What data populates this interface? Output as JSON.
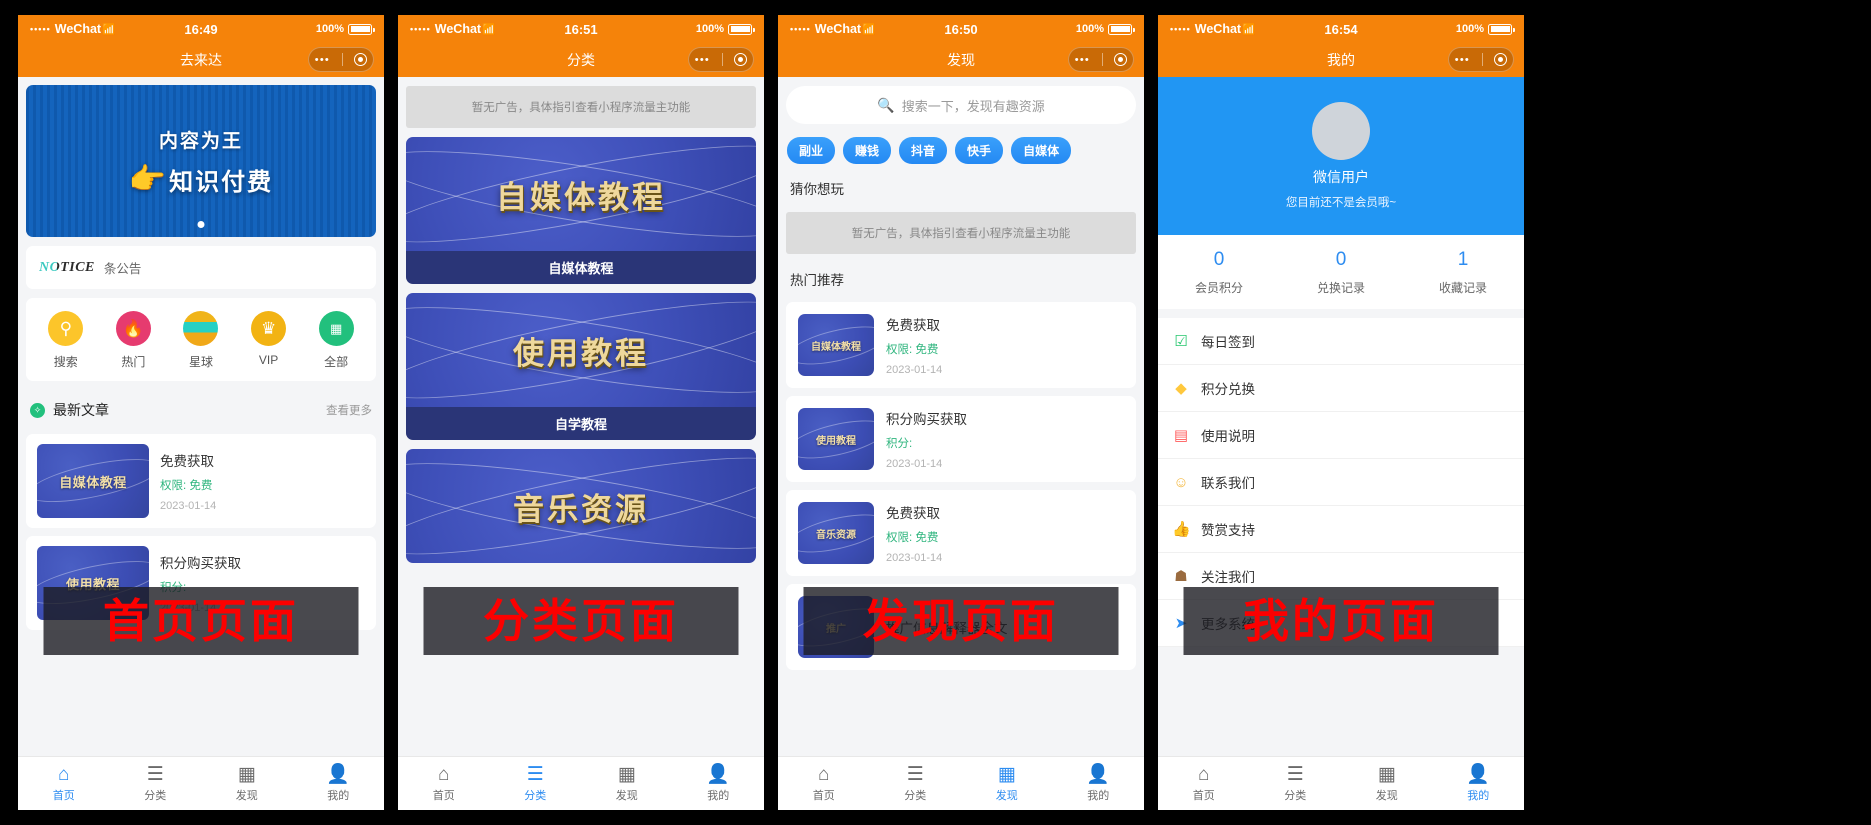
{
  "panels": [
    {
      "status": {
        "carrier": "WeChat",
        "dots": "•••••",
        "wifi": "⌃",
        "time": "16:49",
        "battery": "100%"
      },
      "nav": {
        "title": "去来达"
      },
      "overlay_label": "首页页面",
      "banner": {
        "line1": "内容为王",
        "line2": "知识付费",
        "hand_icon": "point-right-hand-icon"
      },
      "notice": {
        "logo": "NOTICE",
        "text": "条公告"
      },
      "icon_grid": [
        {
          "label": "搜索",
          "icon": "magnifier-icon",
          "glyph": "⌕",
          "color": "#fcc52a"
        },
        {
          "label": "热门",
          "icon": "flame-icon",
          "glyph": "🔥",
          "color": "#e63b6f"
        },
        {
          "label": "星球",
          "icon": "planet-icon",
          "glyph": "",
          "color": "#f0a818"
        },
        {
          "label": "VIP",
          "icon": "crown-icon",
          "glyph": "♕",
          "color": "#f2b313"
        },
        {
          "label": "全部",
          "icon": "grid-icon",
          "glyph": "▦",
          "color": "#22c07d"
        }
      ],
      "section": {
        "title": "最新文章",
        "more": "查看更多",
        "dot_icon": "leaf-icon"
      },
      "articles": [
        {
          "thumb_text": "自媒体教程",
          "title": "免费获取",
          "permission": "权限: 免费",
          "date": "2023-01-14"
        },
        {
          "thumb_text": "使用教程",
          "title": "积分购买获取",
          "permission": "积分:",
          "date": "2023-01-14"
        }
      ],
      "tabbar": [
        {
          "label": "首页",
          "icon": "home-icon",
          "glyph": "⌂",
          "active": true
        },
        {
          "label": "分类",
          "icon": "list-icon",
          "glyph": "☰",
          "active": false
        },
        {
          "label": "发现",
          "icon": "grid-icon",
          "glyph": "▦",
          "active": false
        },
        {
          "label": "我的",
          "icon": "person-icon",
          "glyph": "👤",
          "active": false
        }
      ]
    },
    {
      "status": {
        "carrier": "WeChat",
        "dots": "•••••",
        "wifi": "⌃",
        "time": "16:51",
        "battery": "100%"
      },
      "nav": {
        "title": "分类"
      },
      "overlay_label": "分类页面",
      "ad_placeholder": "暂无广告，具体指引查看小程序流量主功能",
      "category_cards": [
        {
          "image_text": "自媒体教程",
          "caption": "自媒体教程"
        },
        {
          "image_text": "使用教程",
          "caption": "自学教程"
        },
        {
          "image_text": "音乐资源",
          "caption": ""
        }
      ],
      "tabbar": [
        {
          "label": "首页",
          "icon": "home-icon",
          "glyph": "⌂",
          "active": false
        },
        {
          "label": "分类",
          "icon": "list-icon",
          "glyph": "☰",
          "active": true
        },
        {
          "label": "发现",
          "icon": "grid-icon",
          "glyph": "▦",
          "active": false
        },
        {
          "label": "我的",
          "icon": "person-icon",
          "glyph": "👤",
          "active": false
        }
      ]
    },
    {
      "status": {
        "carrier": "WeChat",
        "dots": "•••••",
        "wifi": "⌃",
        "time": "16:50",
        "battery": "100%"
      },
      "nav": {
        "title": "发现"
      },
      "overlay_label": "发现页面",
      "search": {
        "placeholder": "搜索一下，发现有趣资源",
        "icon": "search-icon"
      },
      "tags": [
        "副业",
        "赚钱",
        "抖音",
        "快手",
        "自媒体"
      ],
      "guess_title": "猜你想玩",
      "ad_placeholder": "暂无广告，具体指引查看小程序流量主功能",
      "hot_title": "热门推荐",
      "hot_items": [
        {
          "thumb_text": "自媒体教程",
          "title": "免费获取",
          "permission": "权限: 免费",
          "date": "2023-01-14"
        },
        {
          "thumb_text": "使用教程",
          "title": "积分购买获取",
          "permission": "积分:",
          "date": "2023-01-14"
        },
        {
          "thumb_text": "音乐资源",
          "title": "免费获取",
          "permission": "权限: 免费",
          "date": "2023-01-14"
        },
        {
          "thumb_text": "推广",
          "title": "推广信息解释器全文",
          "permission": "",
          "date": ""
        }
      ],
      "tabbar": [
        {
          "label": "首页",
          "icon": "home-icon",
          "glyph": "⌂",
          "active": false
        },
        {
          "label": "分类",
          "icon": "list-icon",
          "glyph": "☰",
          "active": false
        },
        {
          "label": "发现",
          "icon": "grid-icon",
          "glyph": "▦",
          "active": true
        },
        {
          "label": "我的",
          "icon": "person-icon",
          "glyph": "👤",
          "active": false
        }
      ]
    },
    {
      "status": {
        "carrier": "WeChat",
        "dots": "•••••",
        "wifi": "⌃",
        "time": "16:54",
        "battery": "100%"
      },
      "nav": {
        "title": "我的"
      },
      "overlay_label": "我的页面",
      "profile": {
        "name": "微信用户",
        "desc": "您目前还不是会员哦~",
        "avatar_icon": "avatar-placeholder-icon"
      },
      "stats": [
        {
          "value": "0",
          "label": "会员积分"
        },
        {
          "value": "0",
          "label": "兑换记录"
        },
        {
          "value": "1",
          "label": "收藏记录"
        }
      ],
      "menu": [
        {
          "label": "每日签到",
          "icon": "calendar-check-icon",
          "glyph": "☑",
          "color": "#28c76f"
        },
        {
          "label": "积分兑换",
          "icon": "diamond-icon",
          "glyph": "◆",
          "color": "#ffc83d"
        },
        {
          "label": "使用说明",
          "icon": "clipboard-icon",
          "glyph": "▤",
          "color": "#ff5b5b"
        },
        {
          "label": "联系我们",
          "icon": "chat-face-icon",
          "glyph": "☺",
          "color": "#f4b942"
        },
        {
          "label": "赞赏支持",
          "icon": "thumbs-up-icon",
          "glyph": "👍",
          "color": "#2bb8d8"
        },
        {
          "label": "关注我们",
          "icon": "group-icon",
          "glyph": "☗",
          "color": "#9a6b3f"
        },
        {
          "label": "更多系统",
          "icon": "send-icon",
          "glyph": "➤",
          "color": "#2d8cf0"
        }
      ],
      "tabbar": [
        {
          "label": "首页",
          "icon": "home-icon",
          "glyph": "⌂",
          "active": false
        },
        {
          "label": "分类",
          "icon": "list-icon",
          "glyph": "☰",
          "active": false
        },
        {
          "label": "发现",
          "icon": "grid-icon",
          "glyph": "▦",
          "active": false
        },
        {
          "label": "我的",
          "icon": "person-icon",
          "glyph": "👤",
          "active": true
        }
      ]
    }
  ]
}
